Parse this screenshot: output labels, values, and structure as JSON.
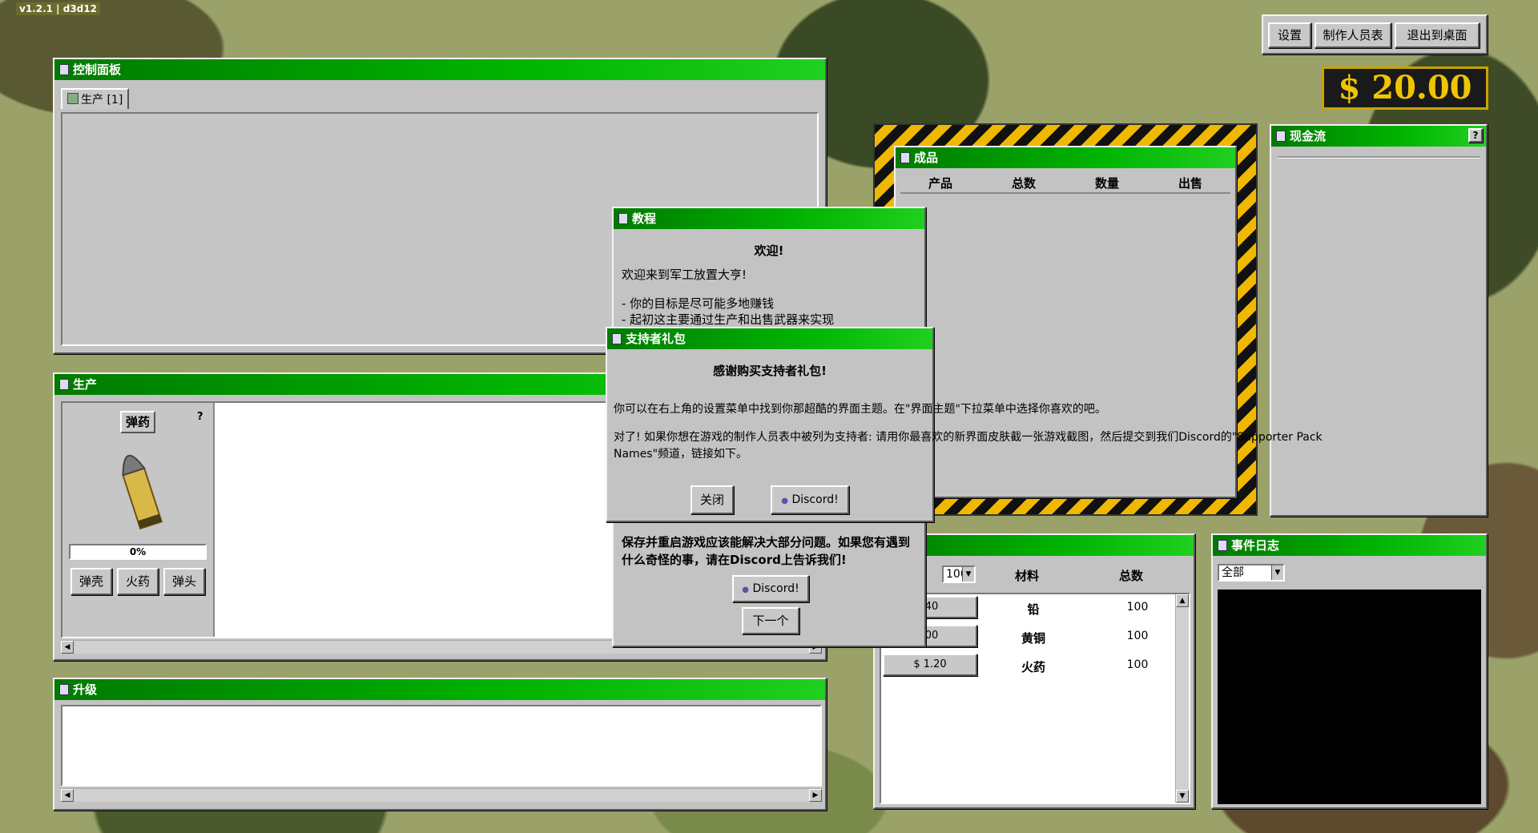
{
  "version": "v1.2.1 | d3d12",
  "topbar": {
    "settings": "设置",
    "credits": "制作人员表",
    "exit": "退出到桌面"
  },
  "money": "$ 20.00",
  "control_panel": {
    "title": "控制面板",
    "tab": "生产 [1]"
  },
  "production": {
    "title": "生产",
    "item_name": "弹药",
    "help": "?",
    "progress_pct": 0,
    "progress_text": "0%",
    "materials": [
      "弹壳",
      "火药",
      "弹头"
    ]
  },
  "upgrades": {
    "title": "升级"
  },
  "products": {
    "title": "成品",
    "columns": [
      "产品",
      "总数",
      "数量",
      "出售"
    ]
  },
  "cashflow": {
    "title": "现金流",
    "help": "?"
  },
  "materials_window": {
    "qty_select": "100",
    "columns": [
      "材料",
      "总数"
    ],
    "rows": [
      {
        "price": ".40",
        "name": "铅",
        "total": "100"
      },
      {
        "price": ".00",
        "name": "黄铜",
        "total": "100"
      },
      {
        "price": "$ 1.20",
        "name": "火药",
        "total": "100"
      }
    ]
  },
  "event_log": {
    "title": "事件日志",
    "filter": "全部"
  },
  "tutorial": {
    "title": "教程",
    "heading": "欢迎!",
    "intro": "欢迎来到军工放置大亨!",
    "bullet1": "- 你的目标是尽可能多地赚钱",
    "bullet2": "- 起初这主要通过生产和出售武器来实现",
    "bottom_text": "保存并重启游戏应该能解决大部分问题。如果您有遇到什么奇怪的事，请在Discord上告诉我们!",
    "discord": "Discord!",
    "next": "下一个"
  },
  "supporter": {
    "title": "支持者礼包",
    "heading": "感谢购买支持者礼包!",
    "para1": "你可以在右上角的设置菜单中找到你那超酷的界面主题。在\"界面主题\"下拉菜单中选择你喜欢的吧。",
    "para2": "对了! 如果你想在游戏的制作人员表中被列为支持者: 请用你最喜欢的新界面皮肤截一张游戏截图，然后提交到我们Discord的\"Supporter Pack Names\"频道，链接如下。",
    "close": "关闭",
    "discord": "Discord!"
  }
}
